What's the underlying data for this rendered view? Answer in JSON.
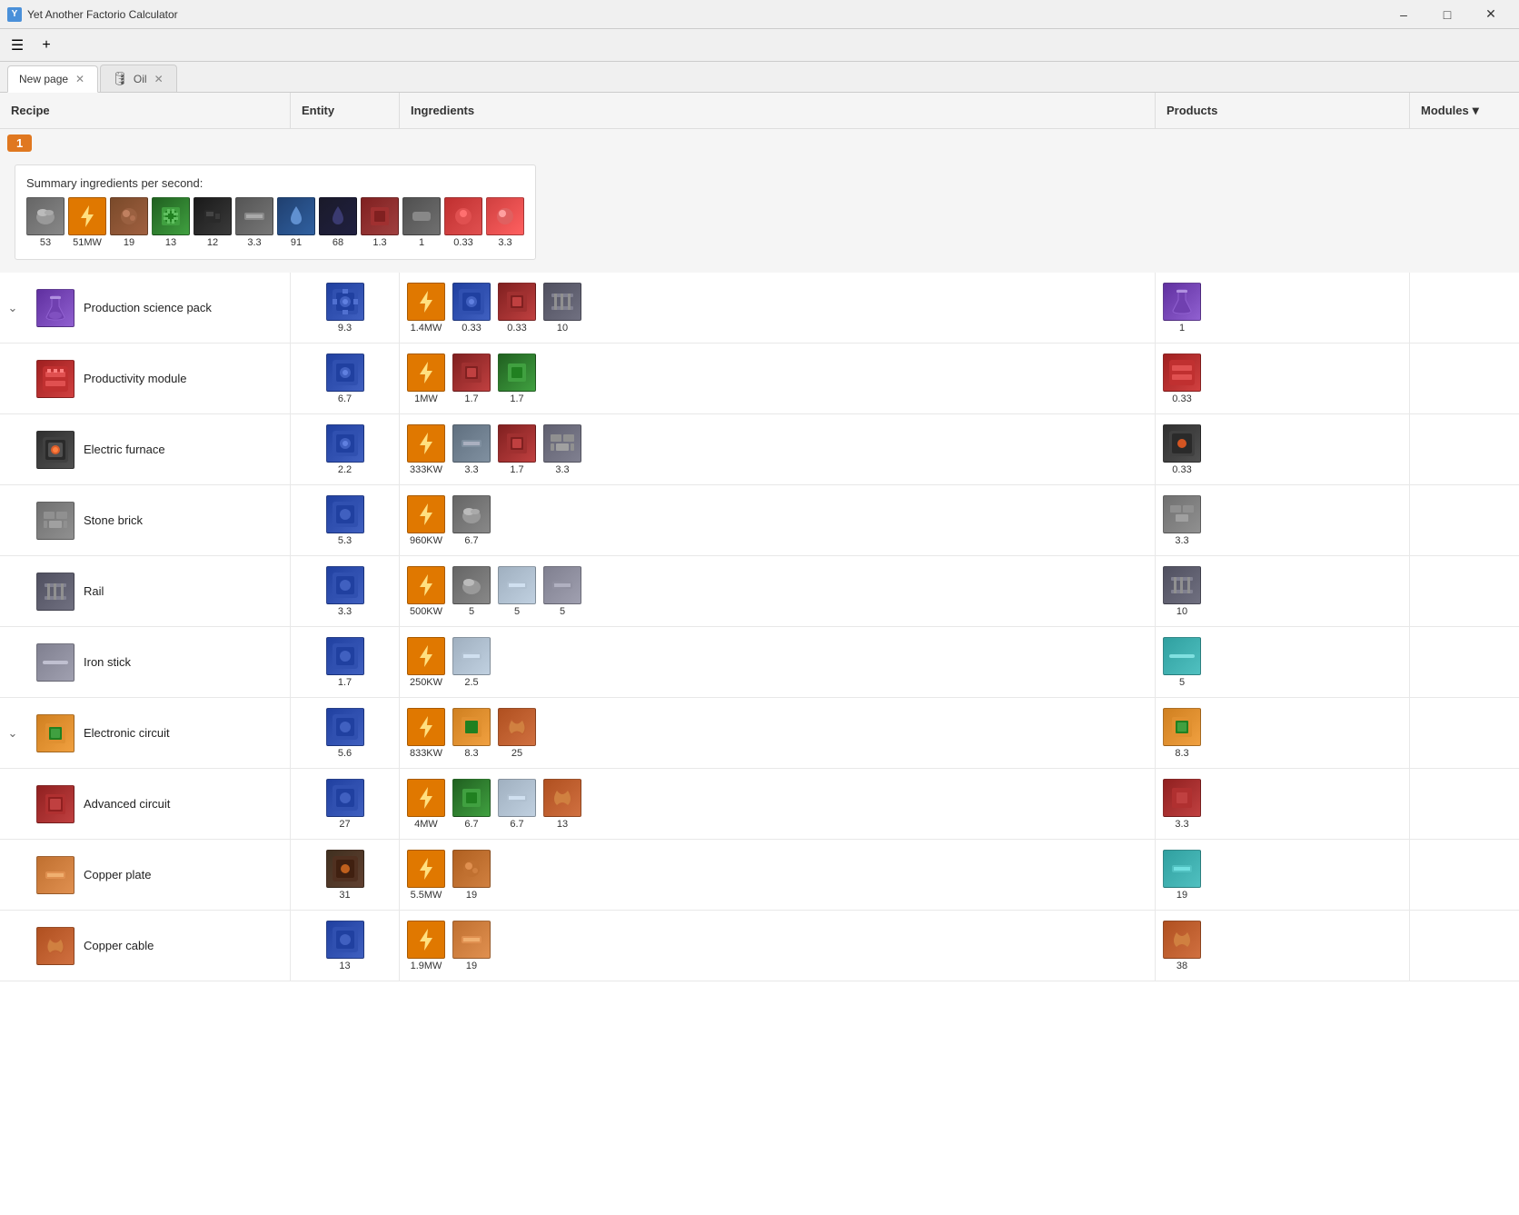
{
  "window": {
    "title": "Yet Another Factorio Calculator",
    "controls": [
      "minimize",
      "maximize",
      "close"
    ]
  },
  "tabs": [
    {
      "id": "new-page",
      "label": "New page",
      "active": true,
      "closeable": true
    },
    {
      "id": "oil",
      "label": "Oil",
      "active": false,
      "closeable": true,
      "icon": "🛢"
    }
  ],
  "columns": {
    "recipe": "Recipe",
    "entity": "Entity",
    "ingredients": "Ingredients",
    "products": "Products",
    "modules": "Modules"
  },
  "summary": {
    "title": "Summary ingredients per second:",
    "items": [
      {
        "icon": "🪨",
        "bg": "#6a6a6a",
        "value": "53"
      },
      {
        "icon": "⚠",
        "bg": "#e07800",
        "value": "51MW"
      },
      {
        "icon": "🪨",
        "bg": "#7a4a2a",
        "value": "19"
      },
      {
        "icon": "🟩",
        "bg": "#208020",
        "value": "13"
      },
      {
        "icon": "⬛",
        "bg": "#222",
        "value": "12"
      },
      {
        "icon": "◆",
        "bg": "#555",
        "value": "3.3"
      },
      {
        "icon": "💧",
        "bg": "#204070",
        "value": "91"
      },
      {
        "icon": "💧",
        "bg": "#404060",
        "value": "68"
      },
      {
        "icon": "🔴",
        "bg": "#802020",
        "value": "1.3"
      },
      {
        "icon": "◯",
        "bg": "#505050",
        "value": "1"
      },
      {
        "icon": "🔴",
        "bg": "#c03030",
        "value": "0.33"
      },
      {
        "icon": "🔴",
        "bg": "#d04040",
        "value": "3.3"
      }
    ]
  },
  "recipes": [
    {
      "id": "production-science-pack",
      "name": "Production science pack",
      "collapsed": false,
      "isGroup": true,
      "icon": "🧪",
      "iconBg": "#8040c0",
      "entity": {
        "icon": "⚙",
        "iconBg": "#2a5080",
        "value": "9.3"
      },
      "energyValue": "1.4MW",
      "ingredients": [
        {
          "icon": "⚙",
          "bg": "#2a5080",
          "value": "0.33"
        },
        {
          "icon": "🔴",
          "bg": "#a03020",
          "value": "0.33"
        },
        {
          "icon": "☰",
          "bg": "#606060",
          "value": "10"
        }
      ],
      "products": [
        {
          "icon": "🧪",
          "bg": "#8040c0",
          "value": "1"
        }
      ]
    },
    {
      "id": "productivity-module",
      "name": "Productivity module",
      "isChild": true,
      "icon": "📦",
      "iconBg": "#c03020",
      "entity": {
        "icon": "⚙",
        "iconBg": "#2a5080",
        "value": "6.7"
      },
      "energyValue": "1MW",
      "ingredients": [
        {
          "icon": "🔴",
          "bg": "#a03020",
          "value": "1.7"
        },
        {
          "icon": "🟩",
          "bg": "#208020",
          "value": "1.7"
        }
      ],
      "products": [
        {
          "icon": "📦",
          "bg": "#c03020",
          "value": "0.33"
        }
      ]
    },
    {
      "id": "electric-furnace",
      "name": "Electric furnace",
      "isChild": true,
      "icon": "🔥",
      "iconBg": "#404040",
      "entity": {
        "icon": "⚙",
        "iconBg": "#2a5080",
        "value": "2.2"
      },
      "energyValue": "333KW",
      "ingredients": [
        {
          "icon": "▬",
          "bg": "#708090",
          "value": "3.3"
        },
        {
          "icon": "🔴",
          "bg": "#a03020",
          "value": "1.7"
        },
        {
          "icon": "◼",
          "bg": "#505060",
          "value": "3.3"
        }
      ],
      "products": [
        {
          "icon": "🔥",
          "bg": "#404040",
          "value": "0.33"
        }
      ]
    },
    {
      "id": "stone-brick",
      "name": "Stone brick",
      "isChild": true,
      "icon": "🧱",
      "iconBg": "#808080",
      "entity": {
        "icon": "⚙",
        "iconBg": "#2a5080",
        "value": "5.3"
      },
      "energyValue": "960KW",
      "ingredients": [
        {
          "icon": "🪨",
          "bg": "#7a7a7a",
          "value": "6.7"
        }
      ],
      "products": [
        {
          "icon": "🧱",
          "bg": "#808080",
          "value": "3.3"
        }
      ]
    },
    {
      "id": "rail",
      "name": "Rail",
      "isChild": true,
      "icon": "☰",
      "iconBg": "#606060",
      "entity": {
        "icon": "⚙",
        "iconBg": "#2a5080",
        "value": "3.3"
      },
      "energyValue": "500KW",
      "ingredients": [
        {
          "icon": "🪨",
          "bg": "#7a7a7a",
          "value": "5"
        },
        {
          "icon": "▬",
          "bg": "#a0a0b0",
          "value": "5"
        },
        {
          "icon": "▬",
          "bg": "#909090",
          "value": "5"
        }
      ],
      "products": [
        {
          "icon": "☰",
          "bg": "#606060",
          "value": "10"
        }
      ]
    },
    {
      "id": "iron-stick",
      "name": "Iron stick",
      "isChild": true,
      "icon": "╱",
      "iconBg": "#909090",
      "entity": {
        "icon": "⚙",
        "iconBg": "#2a5080",
        "value": "1.7"
      },
      "energyValue": "250KW",
      "ingredients": [
        {
          "icon": "▬",
          "bg": "#a0a0b0",
          "value": "2.5"
        }
      ],
      "products": [
        {
          "icon": "╱",
          "bg": "#50b0b0",
          "value": "5"
        }
      ]
    },
    {
      "id": "electronic-circuit",
      "name": "Electronic circuit",
      "collapsed": false,
      "isGroup": true,
      "icon": "🟩",
      "iconBg": "#e08020",
      "entity": {
        "icon": "⚙",
        "iconBg": "#2a5080",
        "value": "5.6"
      },
      "energyValue": "833KW",
      "ingredients": [
        {
          "icon": "🟩",
          "bg": "#e08020",
          "value": "8.3"
        },
        {
          "icon": "🌀",
          "bg": "#b05020",
          "value": "25"
        }
      ],
      "products": [
        {
          "icon": "🟩",
          "bg": "#e08020",
          "value": "8.3"
        }
      ]
    },
    {
      "id": "advanced-circuit",
      "name": "Advanced circuit",
      "isChild": true,
      "icon": "🔴",
      "iconBg": "#a02020",
      "entity": {
        "icon": "⚙",
        "iconBg": "#2a5080",
        "value": "27"
      },
      "energyValue": "4MW",
      "ingredients": [
        {
          "icon": "🟩",
          "bg": "#208020",
          "value": "6.7"
        },
        {
          "icon": "▬",
          "bg": "#a0a0b0",
          "value": "6.7"
        },
        {
          "icon": "🌀",
          "bg": "#b05020",
          "value": "13"
        }
      ],
      "products": [
        {
          "icon": "🔴",
          "bg": "#a02020",
          "value": "3.3"
        }
      ]
    },
    {
      "id": "copper-plate",
      "name": "Copper plate",
      "isChild": true,
      "icon": "▬",
      "iconBg": "#c07030",
      "entity": {
        "icon": "⚙",
        "iconBg": "#403020",
        "value": "31"
      },
      "energyValue": "5.5MW",
      "ingredients": [
        {
          "icon": "🪨",
          "bg": "#b06020",
          "value": "19"
        }
      ],
      "products": [
        {
          "icon": "▬",
          "bg": "#30b0b0",
          "value": "19"
        }
      ]
    },
    {
      "id": "copper-cable",
      "name": "Copper cable",
      "isChild": true,
      "icon": "🌀",
      "iconBg": "#b05020",
      "entity": {
        "icon": "⚙",
        "iconBg": "#2a5080",
        "value": "13"
      },
      "energyValue": "1.9MW",
      "ingredients": [
        {
          "icon": "▬",
          "bg": "#c07030",
          "value": "19"
        }
      ],
      "products": [
        {
          "icon": "🌀",
          "bg": "#b05020",
          "value": "38"
        }
      ]
    }
  ]
}
